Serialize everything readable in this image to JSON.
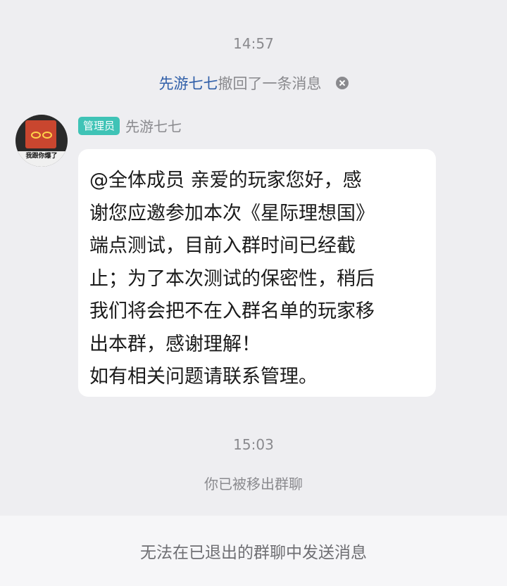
{
  "chat": {
    "timestamp_1": "14:57",
    "recall": {
      "name": "先游七七",
      "text": "撤回了一条消息"
    },
    "message": {
      "avatar_caption": "我跟你爆了",
      "badge": "管理员",
      "sender": "先游七七",
      "lines": [
        "@全体成员 亲爱的玩家您好，感",
        "谢您应邀参加本次《星际理想国》",
        "端点测试，目前入群时间已经截",
        "止；为了本次测试的保密性，稍后",
        "我们将会把不在入群名单的玩家移",
        "出本群，感谢理解！",
        "如有相关问题请联系管理。"
      ]
    },
    "timestamp_2": "15:03",
    "system_note": "你已被移出群聊"
  },
  "bottom_bar": {
    "notice": "无法在已退出的群聊中发送消息"
  },
  "colors": {
    "background": "#eeeef1",
    "recall_name": "#2f5ea8",
    "admin_badge": "#3fc3b6",
    "bubble": "#ffffff"
  }
}
